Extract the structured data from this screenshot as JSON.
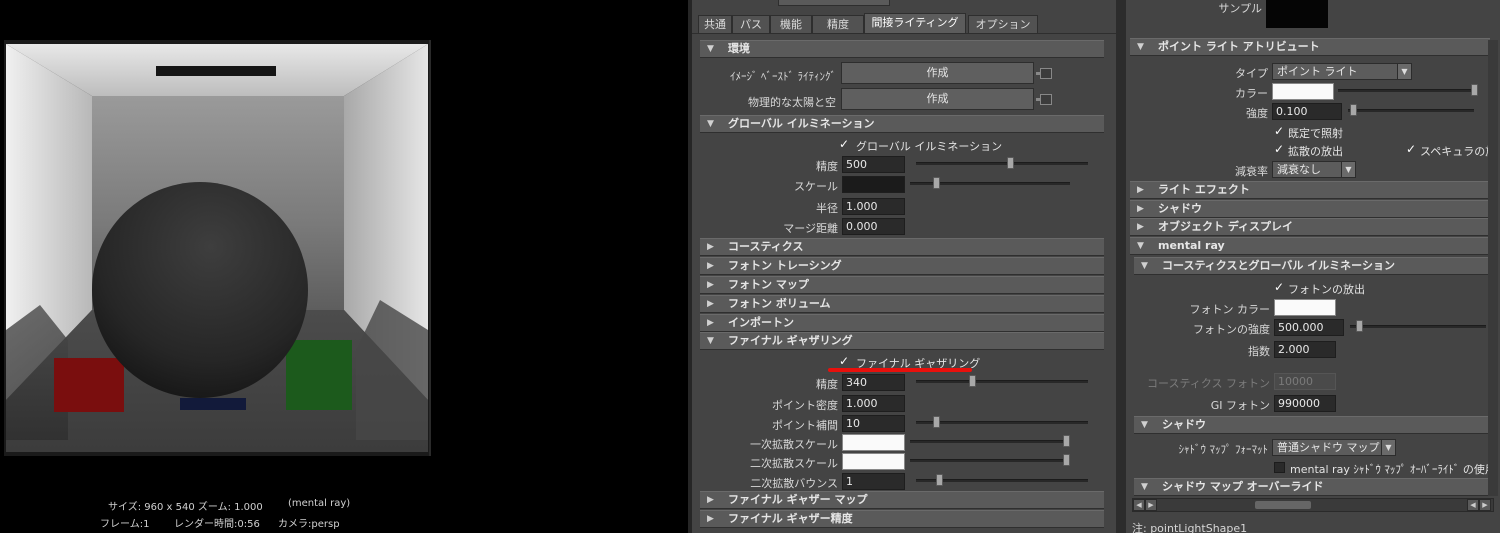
{
  "render_view": {
    "info_line1": "サイズ: 960 x 540 ズーム: 1.000",
    "info_renderer": "(mental ray)",
    "frame": "フレーム:1",
    "render_time": "レンダー時間:0:56",
    "camera": "カメラ:persp"
  },
  "settings": {
    "tabs": [
      "共通",
      "パス",
      "機能",
      "精度",
      "間接ライティング",
      "オプション"
    ],
    "active_tab": "間接ライティング",
    "environment": {
      "header": "環境",
      "ibl_label": "ｲﾒｰｼﾞ ﾍﾞｰｽﾄﾞ ﾗｲﾃｨﾝｸﾞ",
      "ibl_button": "作成",
      "sky_label": "物理的な太陽と空",
      "sky_button": "作成"
    },
    "global_illumination": {
      "header": "グローバル イルミネーション",
      "checkbox_label": "グローバル イルミネーション",
      "checked": true,
      "accuracy_label": "精度",
      "accuracy": "500",
      "accuracy_slider": 0.55,
      "scale_label": "スケール",
      "scale_slider": 0.15,
      "radius_label": "半径",
      "radius": "1.000",
      "merge_label": "マージ距離",
      "merge": "0.000"
    },
    "collapsed_sections": [
      "コースティクス",
      "フォトン トレーシング",
      "フォトン マップ",
      "フォトン ボリューム",
      "インポートン"
    ],
    "final_gather": {
      "header": "ファイナル ギャザリング",
      "checkbox_label": "ファイナル ギャザリング",
      "checked": true,
      "accuracy_label": "精度",
      "accuracy": "340",
      "accuracy_slider": 0.32,
      "point_density_label": "ポイント密度",
      "point_density": "1.000",
      "point_interp_label": "ポイント補間",
      "point_interp": "10",
      "point_interp_slider": 0.1,
      "primary_scale_label": "一次拡散スケール",
      "primary_slider": 1.0,
      "secondary_scale_label": "二次拡散スケール",
      "secondary_slider": 1.0,
      "secondary_bounce_label": "二次拡散バウンス",
      "secondary_bounce": "1",
      "secondary_bounce_slider": 0.12
    },
    "bottom_sections": [
      "ファイナル ギャザー マップ",
      "ファイナル ギャザー精度"
    ],
    "accent_color": "#e8100c"
  },
  "attr": {
    "sample_label": "サンプル",
    "point_light_header": "ポイント ライト アトリビュート",
    "type_label": "タイプ",
    "type_value": "ポイント ライト",
    "color_label": "カラー",
    "color_slider": 1.0,
    "intensity_label": "強度",
    "intensity": "0.100",
    "intensity_slider": 0.02,
    "illum_default": "既定で照射",
    "emit_diffuse": "拡散の放出",
    "emit_specular": "スペキュラの放",
    "decay_label": "減衰率",
    "decay_value": "減衰なし",
    "collapsed": [
      "ライト エフェクト",
      "シャドウ",
      "オブジェクト ディスプレイ"
    ],
    "mental_ray_header": "mental ray",
    "cgi_header": "コースティクスとグローバル イルミネーション",
    "emit_photons": "フォトンの放出",
    "photon_color_label": "フォトン カラー",
    "photon_intensity_label": "フォトンの強度",
    "photon_intensity": "500.000",
    "photon_intensity_slider": 0.05,
    "exponent_label": "指数",
    "exponent": "2.000",
    "caustic_photons_label": "コースティクス フォトン",
    "caustic_photons": "10000",
    "gi_photons_label": "GI フォトン",
    "gi_photons": "990000",
    "shadow_header": "シャドウ",
    "shadow_map_format_label": "ｼｬﾄﾞｳ ﾏｯﾌﾟ ﾌｫｰﾏｯﾄ",
    "shadow_map_format_value": "普通シャドウ マップ",
    "mr_override_label": "mental ray ｼｬﾄﾞｳ ﾏｯﾌﾟ ｵｰﾊﾞｰﾗｲﾄﾞ の使用",
    "shadow_override_header": "シャドウ マップ オーバーライド",
    "note": "注:  pointLightShape1"
  }
}
